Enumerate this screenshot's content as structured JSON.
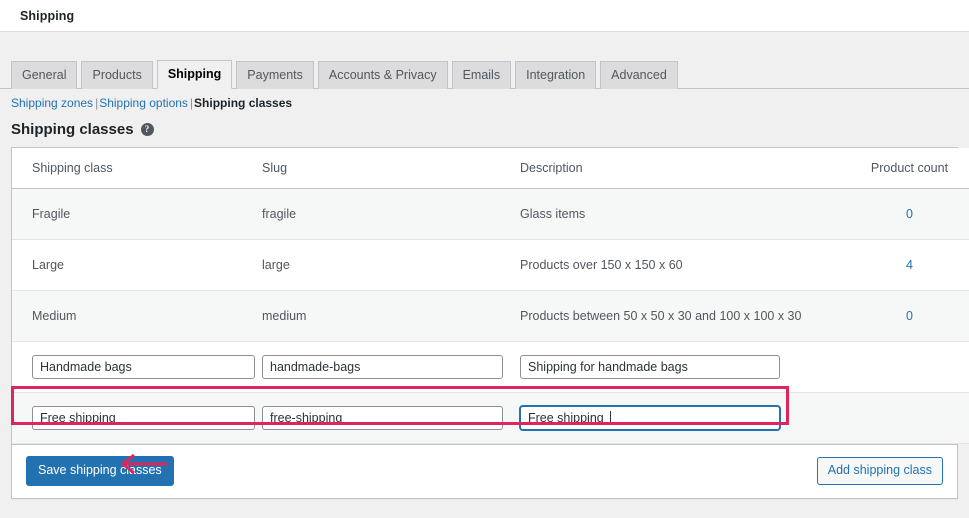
{
  "window": {
    "title": "Shipping"
  },
  "nav_tabs": [
    {
      "label": "General",
      "active": false
    },
    {
      "label": "Products",
      "active": false
    },
    {
      "label": "Shipping",
      "active": true
    },
    {
      "label": "Payments",
      "active": false
    },
    {
      "label": "Accounts & Privacy",
      "active": false
    },
    {
      "label": "Emails",
      "active": false
    },
    {
      "label": "Integration",
      "active": false
    },
    {
      "label": "Advanced",
      "active": false
    }
  ],
  "subnav": {
    "items": [
      {
        "label": "Shipping zones",
        "current": false
      },
      {
        "label": "Shipping options",
        "current": false
      },
      {
        "label": "Shipping classes",
        "current": true
      }
    ],
    "separator": "|"
  },
  "heading": {
    "title": "Shipping classes",
    "help_icon": "help-icon",
    "help_glyph": "?"
  },
  "table": {
    "columns": [
      "Shipping class",
      "Slug",
      "Description",
      "Product count"
    ],
    "rows": [
      {
        "name": "Fragile",
        "slug": "fragile",
        "description": "Glass items",
        "count": "0"
      },
      {
        "name": "Large",
        "slug": "large",
        "description": "Products over 150 x 150 x 60",
        "count": "4"
      },
      {
        "name": "Medium",
        "slug": "medium",
        "description": "Products between 50 x 50 x 30 and 100 x 100 x 30",
        "count": "0"
      }
    ],
    "input_rows": [
      {
        "name": {
          "value": "Handmade bags",
          "placeholder": ""
        },
        "slug": {
          "value": "handmade-bags",
          "placeholder": ""
        },
        "description": {
          "value": "Shipping for handmade bags",
          "placeholder": ""
        },
        "count": "",
        "focused_field": "",
        "highlighted": false
      },
      {
        "name": {
          "value": "Free shipping",
          "placeholder": ""
        },
        "slug": {
          "value": "free-shipping",
          "placeholder": ""
        },
        "description": {
          "value": "Free shipping",
          "placeholder": ""
        },
        "count": "",
        "focused_field": "description",
        "highlighted": true
      }
    ]
  },
  "footer": {
    "save_label": "Save shipping classes",
    "add_label": "Add shipping class"
  },
  "annotations": {
    "highlight_color": "#e0245e",
    "arrow_color": "#e0245e",
    "arrow_direction": "left",
    "arrow_target": "Save shipping classes"
  },
  "colors": {
    "accent": "#2271b1",
    "page_bg": "#f0f0f1",
    "panel_bg": "#ffffff",
    "row_alt_bg": "#f6f7f7",
    "border": "#c3c4c7"
  }
}
